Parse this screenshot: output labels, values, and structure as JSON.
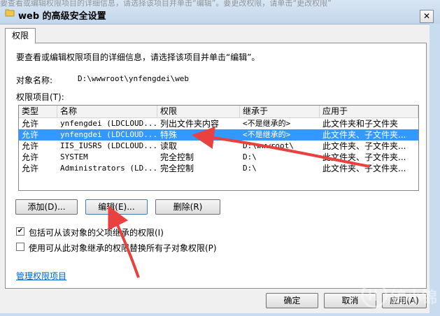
{
  "window": {
    "title": "web 的高级安全设置",
    "behind_text": "要查看或编辑权限项目的详细信息，请选择该项目并单击“编辑”。要更改权限，请单击“更改权限”"
  },
  "tab": {
    "label": "权限"
  },
  "description": "要查看或编辑权限项目的详细信息，请选择该项目并单击“编辑”。",
  "object": {
    "label": "对象名称:",
    "value": "D:\\wwwroot\\ynfengdei\\web"
  },
  "entries_label": "权限项目(T):",
  "table": {
    "columns": [
      "类型",
      "名称",
      "权限",
      "继承于",
      "应用于"
    ],
    "rows": [
      [
        "允许",
        "ynfengdei (LDCLOUD...",
        "列出文件夹内容",
        "<不是继承的>",
        "此文件夹和子文件夹"
      ],
      [
        "允许",
        "ynfengdei (LDCLOUD...",
        "特殊",
        "<不是继承的>",
        "此文件夹、子文件夹..."
      ],
      [
        "允许",
        "IIS_IUSRS (LDCLOUD...",
        "读取",
        "D:\\wwwroot\\",
        "此文件夹、子文件夹..."
      ],
      [
        "允许",
        "SYSTEM",
        "完全控制",
        "D:\\",
        "此文件夹、子文件夹..."
      ],
      [
        "允许",
        "Administrators (LD...",
        "完全控制",
        "D:\\",
        "此文件夹、子文件夹..."
      ]
    ],
    "selected_row": 1
  },
  "buttons": {
    "add": "添加(D)...",
    "edit": "编辑(E)...",
    "remove": "删除(R)"
  },
  "checkboxes": {
    "include_inheritable": {
      "label": "包括可从该对象的父项继承的权限(I)",
      "checked": true
    },
    "replace_child": {
      "label": "使用可从此对象继承的权限替换所有子对象权限(P)",
      "checked": false
    }
  },
  "link": "管理权限项目",
  "footer": {
    "ok": "确定",
    "cancel": "取消",
    "apply": "应用(A)"
  },
  "colors": {
    "selection": "#3399ff",
    "arrow": "#e8413f",
    "link": "#0066cc"
  },
  "watermark": {
    "text": "锦小锦"
  }
}
